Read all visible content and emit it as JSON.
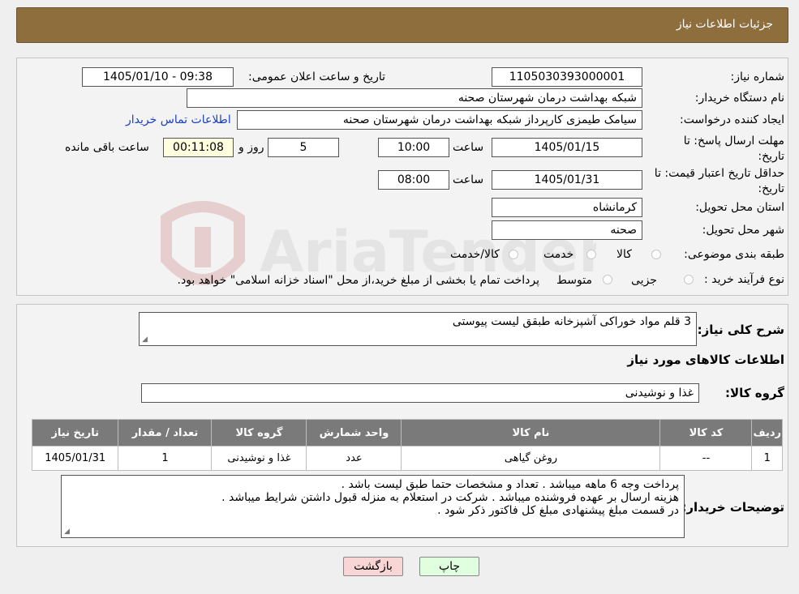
{
  "header": {
    "title": "جزئیات اطلاعات نیاز"
  },
  "watermark_text": "AriaTender.neT",
  "form": {
    "need_number_label": "شماره نیاز:",
    "need_number": "1105030393000001",
    "announce_label": "تاریخ و ساعت اعلان عمومی:",
    "announce_value": "1405/01/10 - 09:38",
    "buyer_org_label": "نام دستگاه خریدار:",
    "buyer_org": "شبکه بهداشت درمان شهرستان صحنه",
    "creator_label": "ایجاد کننده درخواست:",
    "creator": "سیامک طیمزی کارپرداز شبکه بهداشت درمان شهرستان صحنه",
    "contact_link": "اطلاعات تماس خریدار",
    "deadline_label": "مهلت ارسال پاسخ: تا تاریخ:",
    "deadline_date": "1405/01/15",
    "time_label": "ساعت",
    "deadline_time": "10:00",
    "days_value": "5",
    "days_label": "روز و",
    "remaining_time": "00:11:08",
    "remaining_label": "ساعت باقی مانده",
    "validity_label": "حداقل تاریخ اعتبار قیمت: تا تاریخ:",
    "validity_date": "1405/01/31",
    "validity_time": "08:00",
    "province_label": "استان محل تحویل:",
    "province": "کرمانشاه",
    "city_label": "شهر محل تحویل:",
    "city": "صحنه",
    "category_label": "طبقه بندی موضوعی:",
    "category_options": [
      "کالا",
      "خدمت",
      "کالا/خدمت"
    ],
    "process_label": "نوع فرآیند خرید :",
    "process_options": [
      "جزیی",
      "متوسط"
    ],
    "process_note": "پرداخت تمام یا بخشی از مبلغ خرید،از محل \"اسناد خزانه اسلامی\" خواهد بود."
  },
  "details": {
    "summary_label": "شرح کلی نیاز:",
    "summary": "3 قلم مواد خوراکی آشپزخانه طبقق لیست پیوستی",
    "items_heading": "اطلاعات کالاهای مورد نیاز",
    "group_label": "گروه کالا:",
    "group_value": "غذا و نوشیدنی",
    "table": {
      "headers": [
        "ردیف",
        "کد کالا",
        "نام کالا",
        "واحد شمارش",
        "گروه کالا",
        "تعداد / مقدار",
        "تاریخ نیاز"
      ],
      "rows": [
        [
          "1",
          "--",
          "روغن گیاهی",
          "عدد",
          "غذا و نوشیدنی",
          "1",
          "1405/01/31"
        ]
      ]
    },
    "buyer_notes_label": "توضیحات خریدار:",
    "buyer_notes": [
      "پرداخت وجه 6 ماهه میباشد . تعداد و مشخصات حتما طبق لیست باشد .",
      "هزینه ارسال بر عهده فروشنده میباشد . شرکت در استعلام به منزله قبول داشتن شرایط میباشد .",
      "در قسمت مبلغ پیشنهادی مبلغ کل فاکتور ذکر شود ."
    ]
  },
  "buttons": {
    "print": "چاپ",
    "back": "بازگشت"
  },
  "colors": {
    "header_bg": "#8f6e3e",
    "table_header_bg": "#7a7a7a",
    "back_button_bg": "#f9d6d6",
    "print_button_bg": "#dfffdf",
    "remaining_bg": "#ffffdf"
  }
}
